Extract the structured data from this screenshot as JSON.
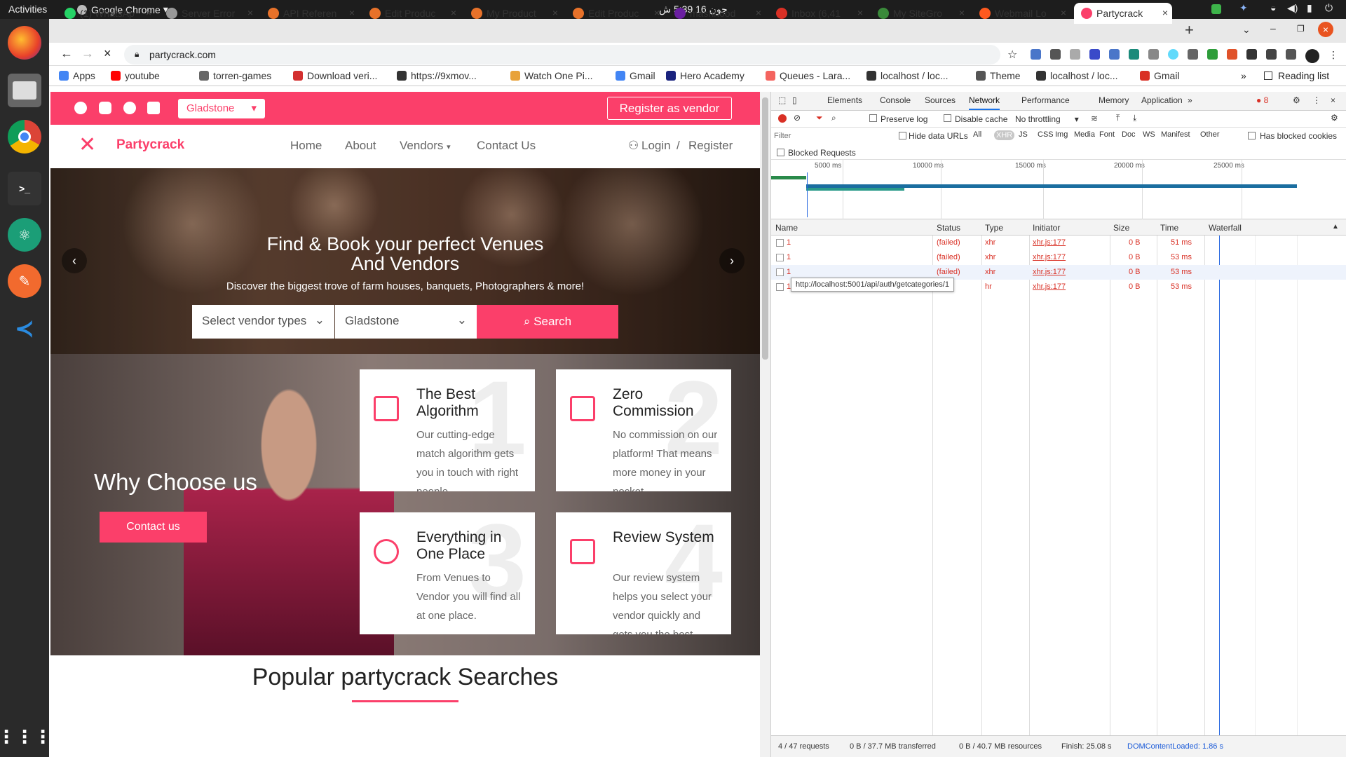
{
  "topbar": {
    "activities": "Activities",
    "app": "Google Chrome",
    "clock": "جون 16  5:39 ش"
  },
  "tabs": [
    {
      "label": "(1) WhatsAp",
      "color": "#25d366"
    },
    {
      "label": "Server Error",
      "color": "#999"
    },
    {
      "label": "API Referen",
      "color": "#e8722a"
    },
    {
      "label": "Edit Produc",
      "color": "#e8722a"
    },
    {
      "label": "My Product",
      "color": "#e8722a"
    },
    {
      "label": "Edit Produc",
      "color": "#e8722a"
    },
    {
      "label": "mashhood",
      "color": "#6a1fa0"
    },
    {
      "label": "Inbox (6,41",
      "color": "#d93025"
    },
    {
      "label": "My SiteGro",
      "color": "#3a8a3a"
    },
    {
      "label": "Webmail Lo",
      "color": "#ff5a1f"
    },
    {
      "label": "Partycrack",
      "color": "#fb3f6a"
    }
  ],
  "address": {
    "url": "partycrack.com"
  },
  "bookmarks": [
    {
      "label": "Apps",
      "color": "#4285f4"
    },
    {
      "label": "youtube",
      "color": "#ff0000"
    },
    {
      "label": "torren-games",
      "color": "#666"
    },
    {
      "label": "Download veri...",
      "color": "#d32f2f"
    },
    {
      "label": "https://9xmov...",
      "color": "#333"
    },
    {
      "label": "Watch One Pi...",
      "color": "#e8a23a"
    },
    {
      "label": "Gmail",
      "color": "#4285f4"
    },
    {
      "label": "Hero Academy",
      "color": "#1a237e"
    },
    {
      "label": "Queues - Lara...",
      "color": "#f4645f"
    },
    {
      "label": "localhost / loc...",
      "color": "#333"
    },
    {
      "label": "Theme",
      "color": "#555"
    },
    {
      "label": "localhost / loc...",
      "color": "#333"
    },
    {
      "label": "Gmail",
      "color": "#d93025"
    }
  ],
  "reading_list": "Reading list",
  "site": {
    "location_select": "Gladstone",
    "register_vendor": "Register as vendor",
    "brand": "Partycrack",
    "nav": {
      "home": "Home",
      "about": "About",
      "vendors": "Vendors",
      "contact": "Contact Us",
      "login": "Login",
      "sep": "/",
      "register": "Register"
    },
    "hero": {
      "title1": "Find & Book your perfect Venues",
      "title2": "And Vendors",
      "subtitle": "Discover the biggest trove of farm houses, banquets, Photographers & more!",
      "vendor_type": "Select vendor types",
      "location": "Gladstone",
      "search": "Search"
    },
    "why": {
      "title": "Why Choose us",
      "contact": "Contact us"
    },
    "features": [
      {
        "num": "1",
        "title": "The Best Algorithm",
        "text": "Our cutting-edge match algorithm gets you in touch with right people",
        "icon": "algorithm-icon"
      },
      {
        "num": "2",
        "title": "Zero Commission",
        "text": "No commission on our platform! That means more money in your pocket",
        "icon": "handshake-icon"
      },
      {
        "num": "3",
        "title": "Everything in One Place",
        "text": "From Venues to Vendor you will find all at one place.",
        "icon": "globe-icon"
      },
      {
        "num": "4",
        "title": "Review System",
        "text": "Our review system helps you select your vendor quickly and gets you the best service.",
        "icon": "review-icon"
      }
    ],
    "popular": "Popular partycrack Searches"
  },
  "devtools": {
    "tabs": [
      "Elements",
      "Console",
      "Sources",
      "Network",
      "Performance",
      "Memory",
      "Application"
    ],
    "active_tab": "Network",
    "error_count": "8",
    "preserve_log": "Preserve log",
    "disable_cache": "Disable cache",
    "throttling": "No throttling",
    "filter_placeholder": "Filter",
    "hide_data_urls": "Hide data URLs",
    "types": [
      "All",
      "XHR",
      "JS",
      "CSS",
      "Img",
      "Media",
      "Font",
      "Doc",
      "WS",
      "Manifest",
      "Other"
    ],
    "has_blocked_cookies": "Has blocked cookies",
    "blocked_requests": "Blocked Requests",
    "timeline_ticks": [
      "5000 ms",
      "10000 ms",
      "15000 ms",
      "20000 ms",
      "25000 ms"
    ],
    "columns": {
      "name": "Name",
      "status": "Status",
      "type": "Type",
      "initiator": "Initiator",
      "size": "Size",
      "time": "Time",
      "waterfall": "Waterfall"
    },
    "rows": [
      {
        "name": "1",
        "status": "(failed)",
        "type": "xhr",
        "initiator": "xhr.js:177",
        "size": "0 B",
        "time": "51 ms"
      },
      {
        "name": "1",
        "status": "(failed)",
        "type": "xhr",
        "initiator": "xhr.js:177",
        "size": "0 B",
        "time": "53 ms"
      },
      {
        "name": "1",
        "status": "(failed)",
        "type": "xhr",
        "initiator": "xhr.js:177",
        "size": "0 B",
        "time": "53 ms"
      },
      {
        "name": "1",
        "status": "",
        "type": "hr",
        "initiator": "xhr.js:177",
        "size": "0 B",
        "time": "53 ms"
      }
    ],
    "tooltip": "http://localhost:5001/api/auth/getcategories/1",
    "status": {
      "requests": "4 / 47 requests",
      "transferred": "0 B / 37.7 MB transferred",
      "resources": "0 B / 40.7 MB resources",
      "finish": "Finish: 25.08 s",
      "dcl": "DOMContentLoaded: 1.86 s"
    }
  }
}
